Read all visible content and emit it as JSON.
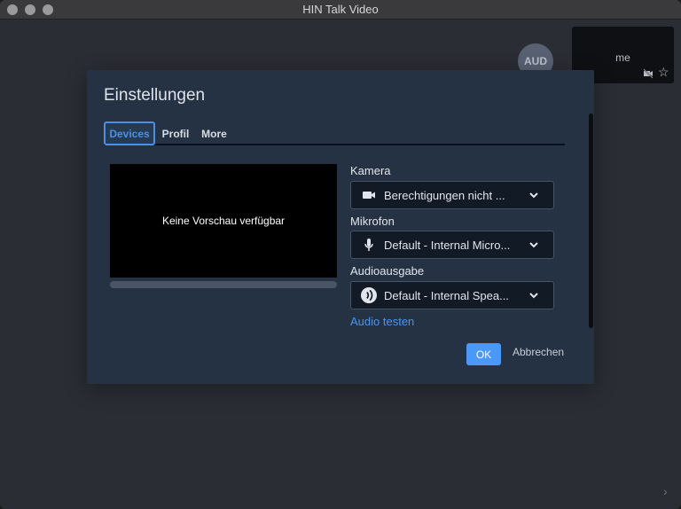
{
  "window": {
    "title": "HIN Talk Video"
  },
  "participants": {
    "avatar_initials": "AUD",
    "self_label": "me"
  },
  "dialog": {
    "title": "Einstellungen",
    "tabs": [
      {
        "label": "Devices"
      },
      {
        "label": "Profil"
      },
      {
        "label": "More"
      }
    ],
    "preview_text": "Keine Vorschau verfügbar",
    "camera": {
      "label": "Kamera",
      "value": "Berechtigungen nicht ..."
    },
    "microphone": {
      "label": "Mikrofon",
      "value": "Default - Internal Micro..."
    },
    "audio_output": {
      "label": "Audioausgabe",
      "value": "Default - Internal Spea..."
    },
    "test_audio_label": "Audio testen",
    "ok_label": "OK",
    "cancel_label": "Abbrechen"
  },
  "icons": {
    "star": "☆",
    "next": "›"
  },
  "colors": {
    "accent": "#4a98fa",
    "dialog_bg": "#253244",
    "background": "#2a2d33"
  }
}
